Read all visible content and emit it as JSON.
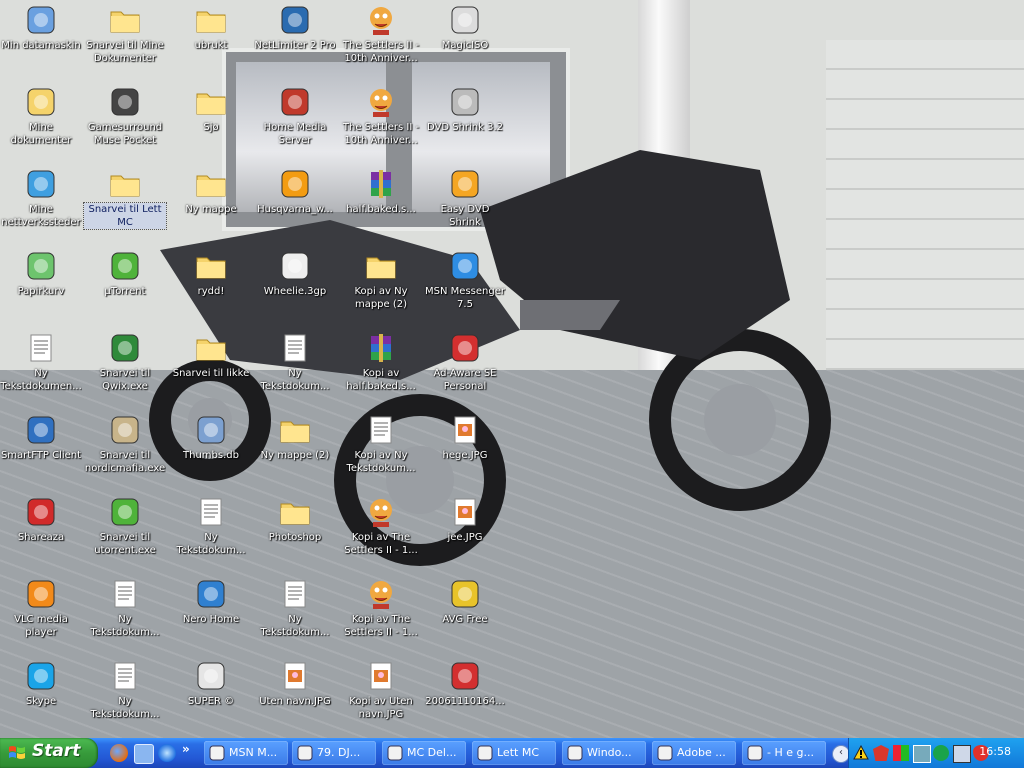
{
  "desktop": {
    "icons": [
      {
        "label": "Min datamaskin",
        "icon": "my-computer-icon"
      },
      {
        "label": "Mine dokumenter",
        "icon": "my-documents-icon"
      },
      {
        "label": "Mine nettverkssteder",
        "icon": "network-places-icon"
      },
      {
        "label": "Papirkurv",
        "icon": "recycle-bin-icon"
      },
      {
        "label": "Ny Tekstdokumen...",
        "icon": "text-document-icon"
      },
      {
        "label": "SmartFTP Client",
        "icon": "smartftp-icon"
      },
      {
        "label": "Shareaza",
        "icon": "shareaza-icon"
      },
      {
        "label": "VLC media player",
        "icon": "vlc-icon"
      },
      {
        "label": "Skype",
        "icon": "skype-icon"
      },
      {
        "label": "Snarvei til Mine Dokumenter",
        "icon": "folder-icon"
      },
      {
        "label": "Gamesurround Muse Pocket",
        "icon": "speaker-icon"
      },
      {
        "label": "Snarvei til Lett MC",
        "icon": "folder-icon"
      },
      {
        "label": "µTorrent",
        "icon": "utorrent-icon"
      },
      {
        "label": "Snarvei til Qwix.exe",
        "icon": "qwix-icon"
      },
      {
        "label": "Snarvei til nordicmafia.exe",
        "icon": "camel-icon"
      },
      {
        "label": "Snarvei til utorrent.exe",
        "icon": "utorrent-icon"
      },
      {
        "label": "Ny Tekstdokum...",
        "icon": "text-document-icon"
      },
      {
        "label": "Ny Tekstdokum...",
        "icon": "text-document-icon"
      },
      {
        "label": "ubrukt",
        "icon": "folder-icon"
      },
      {
        "label": "Sjø",
        "icon": "folder-icon"
      },
      {
        "label": "Ny mappe",
        "icon": "folder-icon"
      },
      {
        "label": "rydd!",
        "icon": "folder-icon"
      },
      {
        "label": "Snarvei til likke",
        "icon": "folder-icon"
      },
      {
        "label": "Thumbs.db",
        "icon": "thumbs-db-icon"
      },
      {
        "label": "Ny Tekstdokum...",
        "icon": "text-document-icon"
      },
      {
        "label": "Nero Home",
        "icon": "nero-icon"
      },
      {
        "label": "SUPER ©",
        "icon": "super-icon"
      },
      {
        "label": "NetLimiter 2 Pro",
        "icon": "netlimiter-icon"
      },
      {
        "label": "Home Media Server",
        "icon": "home-media-icon"
      },
      {
        "label": "Husqvarna_w...",
        "icon": "media-player-icon"
      },
      {
        "label": "Wheelie.3gp",
        "icon": "video-file-icon"
      },
      {
        "label": "Ny Tekstdokum...",
        "icon": "text-document-icon"
      },
      {
        "label": "Ny mappe (2)",
        "icon": "folder-icon"
      },
      {
        "label": "Photoshop",
        "icon": "folder-icon"
      },
      {
        "label": "Ny Tekstdokum...",
        "icon": "text-document-icon"
      },
      {
        "label": "Uten navn.JPG",
        "icon": "jpg-icon"
      },
      {
        "label": "The Settlers II - 10th Anniver...",
        "icon": "settlers-icon"
      },
      {
        "label": "The Settlers II - 10th Anniver...",
        "icon": "settlers-icon"
      },
      {
        "label": "half.baked.s...",
        "icon": "winrar-icon"
      },
      {
        "label": "Kopi av Ny mappe (2)",
        "icon": "folder-icon"
      },
      {
        "label": "Kopi av half.baked.s...",
        "icon": "winrar-icon"
      },
      {
        "label": "Kopi av Ny Tekstdokum...",
        "icon": "text-document-icon"
      },
      {
        "label": "Kopi av The Settlers II - 1...",
        "icon": "settlers-icon"
      },
      {
        "label": "Kopi av The Settlers II - 1...",
        "icon": "settlers-icon"
      },
      {
        "label": "Kopi av Uten navn.JPG",
        "icon": "jpg-icon"
      },
      {
        "label": "MagicISO",
        "icon": "magiciso-icon"
      },
      {
        "label": "DVD Shrink 3.2",
        "icon": "dvd-shrink-icon"
      },
      {
        "label": "Easy DVD Shrink",
        "icon": "easy-dvd-icon"
      },
      {
        "label": "MSN Messenger 7.5",
        "icon": "msn-icon"
      },
      {
        "label": "Ad-Aware SE Personal",
        "icon": "adaware-icon"
      },
      {
        "label": "hege.JPG",
        "icon": "jpg-icon"
      },
      {
        "label": "jee.JPG",
        "icon": "jpg-icon"
      },
      {
        "label": "AVG Free",
        "icon": "avg-icon"
      },
      {
        "label": "20061110164...",
        "icon": "pdf-icon"
      }
    ]
  },
  "taskbar": {
    "start_label": "Start",
    "quick_launch_more": "»",
    "buttons": [
      {
        "label": "MSN M...",
        "icon": "msn-icon"
      },
      {
        "label": "79. DJ...",
        "icon": "pencil-icon"
      },
      {
        "label": "MC Del...",
        "icon": "firefox-icon"
      },
      {
        "label": "Lett MC",
        "icon": "folder-icon"
      },
      {
        "label": "Windo...",
        "icon": "window-icon"
      },
      {
        "label": "Adobe ...",
        "icon": "adobe-icon"
      },
      {
        "label": "- H e g...",
        "icon": "messenger-icon"
      }
    ],
    "clock": "16:58"
  }
}
